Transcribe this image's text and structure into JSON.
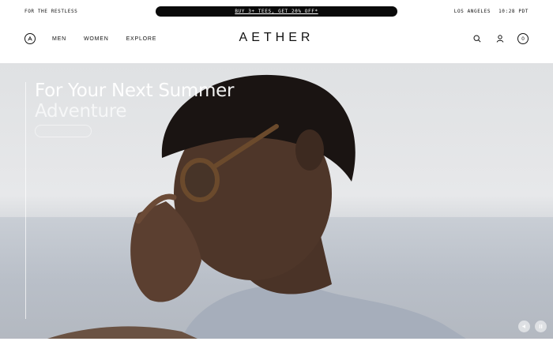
{
  "utility": {
    "tagline": "FOR THE RESTLESS",
    "promo": "BUY 3+ TEES, GET 20% OFF*",
    "location": "LOS ANGELES",
    "time": "10:28 PDT"
  },
  "nav": {
    "links": [
      "MEN",
      "WOMEN",
      "EXPLORE"
    ],
    "brand": "AETHER",
    "cart_count": "0"
  },
  "hero": {
    "title_line1": "For Your Next Summer",
    "title_line2": "Adventure"
  },
  "icons": {
    "logo": "aether-logo-icon",
    "search": "search-icon",
    "account": "user-icon",
    "cart": "cart-icon",
    "mute": "volume-icon",
    "pause": "pause-icon"
  }
}
